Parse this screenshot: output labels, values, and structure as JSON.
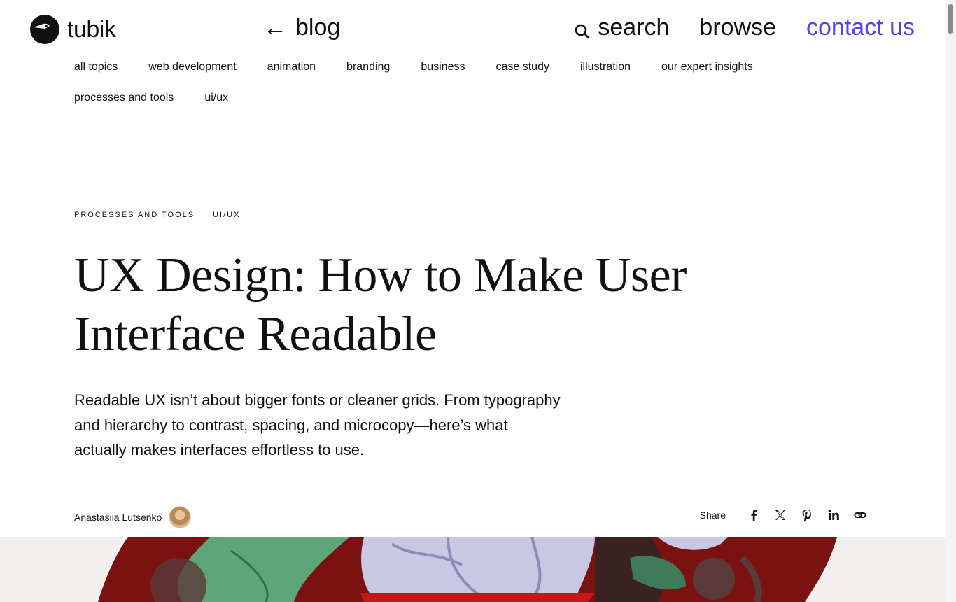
{
  "header": {
    "logo_text": "tubik",
    "back_arrow": "←",
    "back_label": "blog",
    "nav": {
      "search_label": "search",
      "browse_label": "browse",
      "contact_label": "contact us"
    }
  },
  "topics": [
    "all topics",
    "web development",
    "animation",
    "branding",
    "business",
    "case study",
    "illustration",
    "our expert insights",
    "processes and tools",
    "ui/ux"
  ],
  "article": {
    "tags": [
      "PROCESSES AND TOOLS",
      "UI/UX"
    ],
    "title": "UX Design: How to Make User Interface Readable",
    "lead": "Readable UX isn’t about bigger fonts or cleaner grids. From typography and hierarchy to contrast, spacing, and microcopy—here’s what actually makes interfaces effortless to use.",
    "author_name": "Anastasiia Lutsenko",
    "share_label": "Share"
  },
  "icons": {
    "logo": "bird-logo-icon",
    "search": "search-icon",
    "share": [
      "facebook-icon",
      "x-icon",
      "pinterest-icon",
      "linkedin-icon",
      "copy-link-icon"
    ]
  },
  "colors": {
    "accent": "#5b3df5",
    "text": "#111111",
    "background": "#ffffff"
  }
}
